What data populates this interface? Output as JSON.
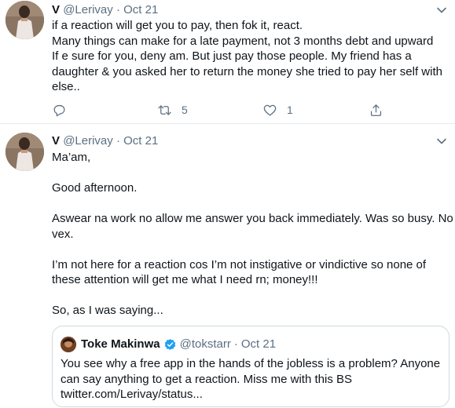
{
  "colors": {
    "text_primary": "#0f1419",
    "text_secondary": "#5b7083",
    "divider": "#e6ecf0",
    "verified_blue": "#1da1f2"
  },
  "tweets": [
    {
      "author_name": "V",
      "handle": "@Lerivay",
      "separator": "·",
      "date": "Oct 21",
      "lines": [
        "if a reaction will get you to pay, then fok it, react.",
        "Many things can make for a late payment, not 3 months debt and upward",
        "If e sure for you, deny am. But just pay those people. My friend has a",
        "daughter & you asked her to return the money she tried to pay her self with",
        "else.."
      ],
      "actions": {
        "reply_icon": "reply-icon",
        "retweet_icon": "retweet-icon",
        "retweet_count": "5",
        "like_icon": "heart-icon",
        "like_count": "1",
        "share_icon": "share-icon"
      }
    },
    {
      "author_name": "V",
      "handle": "@Lerivay",
      "separator": "·",
      "date": "Oct 21",
      "lines": [
        "Ma’am,",
        "",
        "Good afternoon.",
        "",
        "Aswear na work no allow me answer you back immediately. Was so busy. No",
        "vex.",
        "",
        "I’m not here for a reaction cos I’m not instigative or vindictive so none of",
        "these attention will get me what I need rn; money!!!",
        "",
        "So, as I was saying..."
      ],
      "quote": {
        "author_name": "Toke Makinwa",
        "handle": "@tokstarr",
        "separator": "·",
        "date": "Oct 21",
        "lines": [
          "You see why a free app in the hands of the jobless is a problem? Anyone",
          "can say anything to get a reaction. Miss me with this BS",
          "twitter.com/Lerivay/status..."
        ]
      }
    }
  ]
}
